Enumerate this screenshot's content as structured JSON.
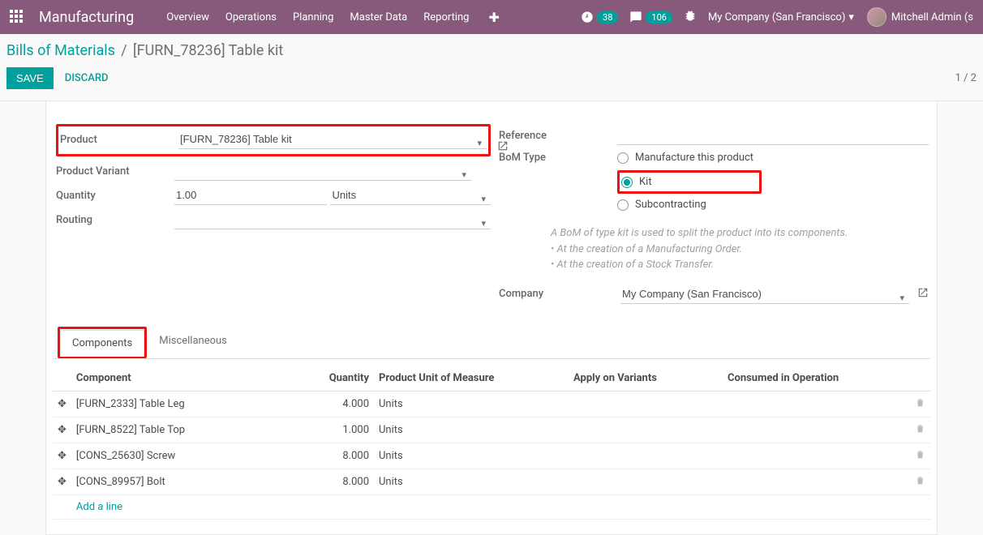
{
  "header": {
    "app": "Manufacturing",
    "nav": [
      "Overview",
      "Operations",
      "Planning",
      "Master Data",
      "Reporting"
    ],
    "activities_count": "38",
    "messages_count": "106",
    "company": "My Company (San Francisco)",
    "user": "Mitchell Admin (s"
  },
  "breadcrumb": {
    "root": "Bills of Materials",
    "current": "[FURN_78236] Table kit"
  },
  "actions": {
    "save": "SAVE",
    "discard": "DISCARD",
    "pager": "1 / 2"
  },
  "form": {
    "labels": {
      "product": "Product",
      "variant": "Product Variant",
      "quantity": "Quantity",
      "routing": "Routing",
      "reference": "Reference",
      "bom_type": "BoM Type",
      "company": "Company"
    },
    "product": "[FURN_78236] Table kit",
    "variant": "",
    "quantity": "1.00",
    "uom": "Units",
    "routing": "",
    "reference": "",
    "bom_type_options": {
      "manufacture": "Manufacture this product",
      "kit": "Kit",
      "subcontracting": "Subcontracting"
    },
    "bom_type_selected": "kit",
    "help": {
      "line1": "A BoM of type kit is used to split the product into its components.",
      "line2": "At the creation of a Manufacturing Order.",
      "line3": "At the creation of a Stock Transfer."
    },
    "company": "My Company (San Francisco)"
  },
  "tabs": {
    "components": "Components",
    "misc": "Miscellaneous"
  },
  "components": {
    "headers": {
      "component": "Component",
      "quantity": "Quantity",
      "uom": "Product Unit of Measure",
      "apply": "Apply on Variants",
      "consumed": "Consumed in Operation"
    },
    "rows": [
      {
        "name": "[FURN_2333] Table Leg",
        "qty": "4.000",
        "uom": "Units"
      },
      {
        "name": "[FURN_8522] Table Top",
        "qty": "1.000",
        "uom": "Units"
      },
      {
        "name": "[CONS_25630] Screw",
        "qty": "8.000",
        "uom": "Units"
      },
      {
        "name": "[CONS_89957] Bolt",
        "qty": "8.000",
        "uom": "Units"
      }
    ],
    "add_line": "Add a line"
  }
}
